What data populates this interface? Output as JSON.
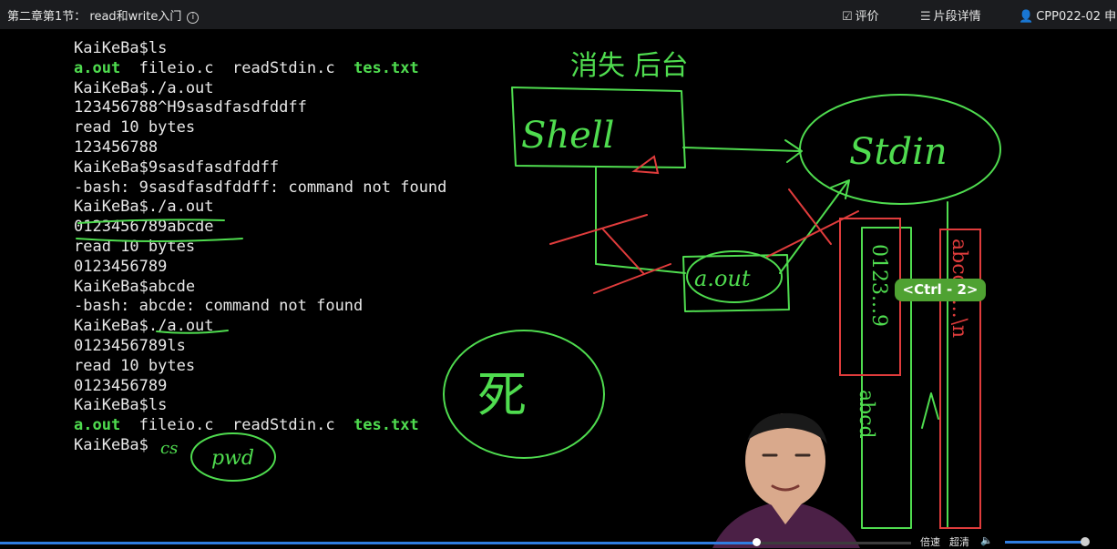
{
  "topbar": {
    "course_title": "第二章第1节： read和write入门",
    "info_icon": "info-circle-icon",
    "actions": [
      {
        "name": "rate-button",
        "icon": "edit-icon",
        "glyph": "☑",
        "label": "评价"
      },
      {
        "name": "segment-details-button",
        "icon": "list-icon",
        "glyph": "☰",
        "label": "片段详情"
      },
      {
        "name": "user-button",
        "icon": "user-icon",
        "glyph": "👤",
        "label": "CPP022-02 申"
      }
    ]
  },
  "terminal": {
    "lines": [
      [
        "KaiKeBa$ls"
      ],
      [
        {
          "text": "a.out",
          "color": "green"
        },
        "  fileio.c  readStdin.c  ",
        {
          "text": "tes.txt",
          "color": "green"
        }
      ],
      [
        "KaiKeBa$./a.out"
      ],
      [
        "123456788^H9sasdfasdfddff"
      ],
      [
        "read 10 bytes"
      ],
      [
        "123456788"
      ],
      [
        "KaiKeBa$9sasdfasdfddff"
      ],
      [
        "-bash: 9sasdfasdfddff: command not found"
      ],
      [
        "KaiKeBa$./a.out"
      ],
      [
        "0123456789abcde"
      ],
      [
        "read 10 bytes"
      ],
      [
        "0123456789"
      ],
      [
        "KaiKeBa$abcde"
      ],
      [
        "-bash: abcde: command not found"
      ],
      [
        "KaiKeBa$./a.out"
      ],
      [
        "0123456789ls"
      ],
      [
        "read 10 bytes"
      ],
      [
        "0123456789"
      ],
      [
        "KaiKeBa$ls"
      ],
      [
        {
          "text": "a.out",
          "color": "green"
        },
        "  fileio.c  readStdin.c  ",
        {
          "text": "tes.txt",
          "color": "green"
        }
      ],
      [
        "KaiKeBa$"
      ]
    ]
  },
  "annotations": {
    "shell_label": "Shell",
    "stdin_label": "Stdin",
    "aout_label": "a.out",
    "top_handwriting": "消失 后台",
    "pwd_label": "pwd",
    "cs_label": "cs",
    "left_column_chars": "0123...9",
    "middle_column_chars": "abcd",
    "right_column_chars": "abcde...\\n"
  },
  "overlay": {
    "ctrl_shortcut": "<Ctrl - 2>"
  },
  "player": {
    "progress_fraction": 0.83,
    "speed_label": "倍速",
    "quality_label": "超清",
    "volume_icon": "speaker-icon",
    "volume_fraction": 0.93
  },
  "colors": {
    "annotation_green": "#4fdc4f",
    "annotation_red": "#e03c3c",
    "accent_blue": "#2f7de1"
  }
}
